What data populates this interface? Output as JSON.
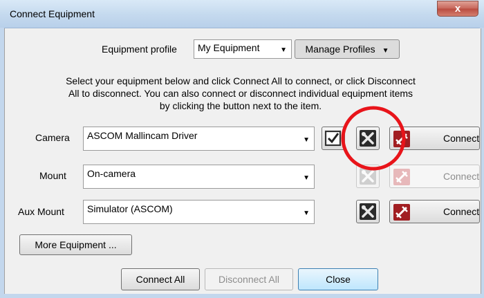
{
  "window": {
    "title": "Connect Equipment",
    "close_glyph": "x"
  },
  "profile": {
    "label": "Equipment profile",
    "selected": "My Equipment",
    "manage_label": "Manage Profiles"
  },
  "instructions": [
    "Select your equipment below and click Connect All to connect, or click Disconnect",
    "All to disconnect. You can also connect or disconnect individual equipment items",
    "by clicking the button next to the item."
  ],
  "equipment": [
    {
      "label": "Camera",
      "device": "ASCOM Mallincam Driver",
      "connect_label": "Connect",
      "enabled": true
    },
    {
      "label": "Mount",
      "device": "On-camera",
      "connect_label": "Connect",
      "enabled": false
    },
    {
      "label": "Aux Mount",
      "device": "Simulator (ASCOM)",
      "connect_label": "Connect",
      "enabled": true
    }
  ],
  "more_equipment_label": "More Equipment ...",
  "footer": {
    "connect_all": "Connect All",
    "disconnect_all": "Disconnect All",
    "close": "Close"
  },
  "colors": {
    "annotation_circle": "#e8141a",
    "plug_red": "#a11e22"
  },
  "icons": [
    "setup-icon",
    "plug-icon",
    "checkbox-icon",
    "dropdown-arrow-icon"
  ]
}
